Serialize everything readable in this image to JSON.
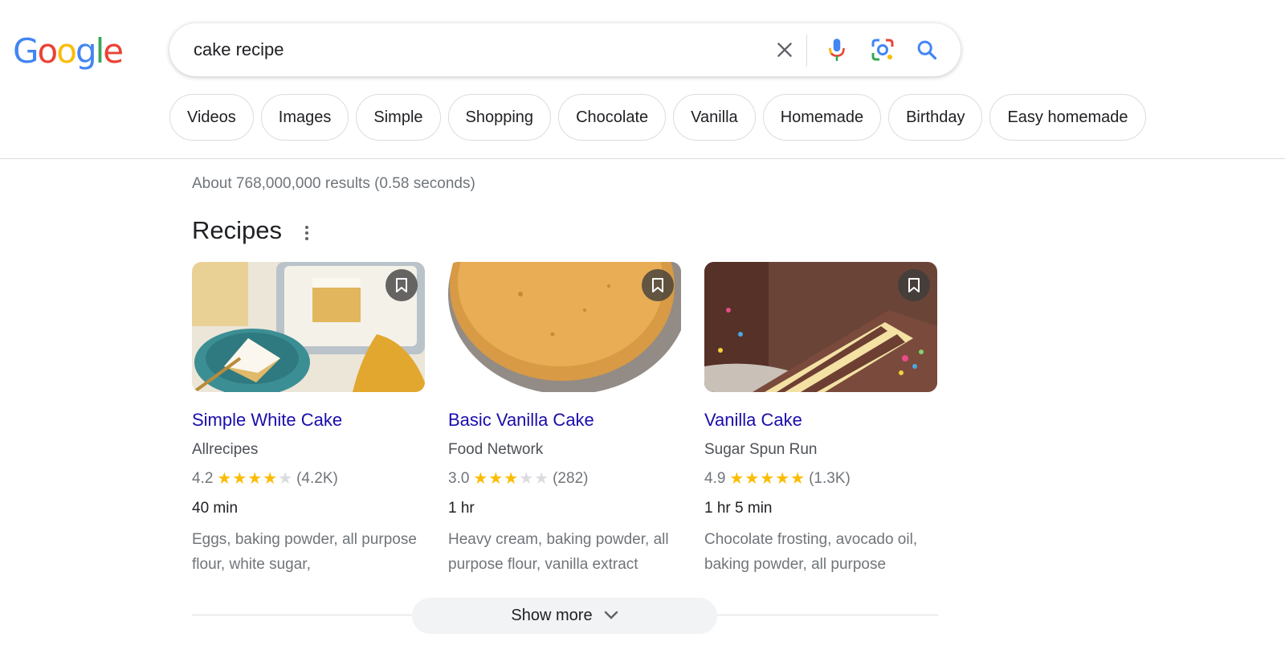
{
  "logo": {
    "letters": [
      {
        "ch": "G",
        "color": "#4285F4"
      },
      {
        "ch": "o",
        "color": "#EA4335"
      },
      {
        "ch": "o",
        "color": "#FBBC05"
      },
      {
        "ch": "g",
        "color": "#4285F4"
      },
      {
        "ch": "l",
        "color": "#34A853"
      },
      {
        "ch": "e",
        "color": "#EA4335"
      }
    ]
  },
  "search": {
    "query": "cake recipe",
    "icons": [
      "clear-icon",
      "microphone-icon",
      "lens-camera-icon",
      "search-icon"
    ]
  },
  "chips": [
    "Videos",
    "Images",
    "Simple",
    "Shopping",
    "Chocolate",
    "Vanilla",
    "Homemade",
    "Birthday",
    "Easy homemade"
  ],
  "result_stats": "About 768,000,000 results (0.58 seconds)",
  "recipes": {
    "heading": "Recipes",
    "cards": [
      {
        "title": "Simple White Cake",
        "source": "Allrecipes",
        "rating": "4.2",
        "stars_filled": 4,
        "review_count": "(4.2K)",
        "time": "40 min",
        "ingredients": "Eggs, baking powder, all purpose flour, white sugar,"
      },
      {
        "title": "Basic Vanilla Cake",
        "source": "Food Network",
        "rating": "3.0",
        "stars_filled": 3,
        "review_count": "(282)",
        "time": "1 hr",
        "ingredients": "Heavy cream, baking powder, all purpose flour, vanilla extract"
      },
      {
        "title": "Vanilla Cake",
        "source": "Sugar Spun Run",
        "rating": "4.9",
        "stars_filled": 5,
        "review_count": "(1.3K)",
        "time": "1 hr 5 min",
        "ingredients": "Chocolate frosting, avocado oil, baking powder, all purpose"
      }
    ]
  },
  "show_more_label": "Show more",
  "colors": {
    "link": "#1a0dab",
    "star": "#fbbc04",
    "muted": "#70757a"
  }
}
